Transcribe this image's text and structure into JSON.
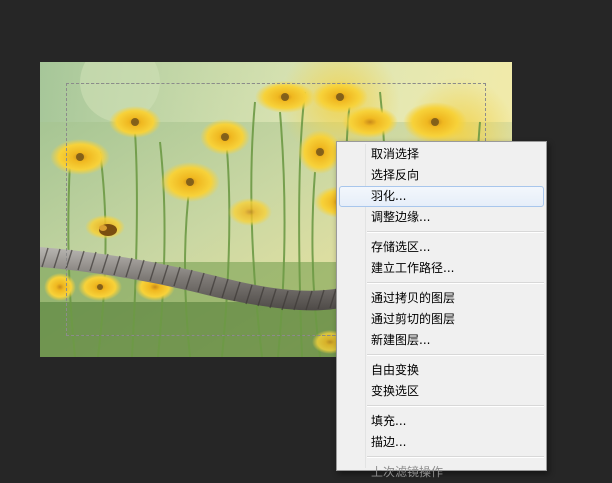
{
  "canvas": {
    "background": "#262626",
    "image_content": "yellow-flowers-with-rope-photo"
  },
  "selection": {
    "style": "dashed-marquee"
  },
  "context_menu": {
    "highlighted_index": 2,
    "groups": [
      [
        "取消选择",
        "选择反向",
        "羽化...",
        "调整边缘..."
      ],
      [
        "存储选区...",
        "建立工作路径..."
      ],
      [
        "通过拷贝的图层",
        "通过剪切的图层",
        "新建图层..."
      ],
      [
        "自由变换",
        "变换选区"
      ],
      [
        "填充...",
        "描边..."
      ],
      [
        "上次滤镜操作"
      ]
    ],
    "disabled_items": [
      "上次滤镜操作"
    ]
  }
}
